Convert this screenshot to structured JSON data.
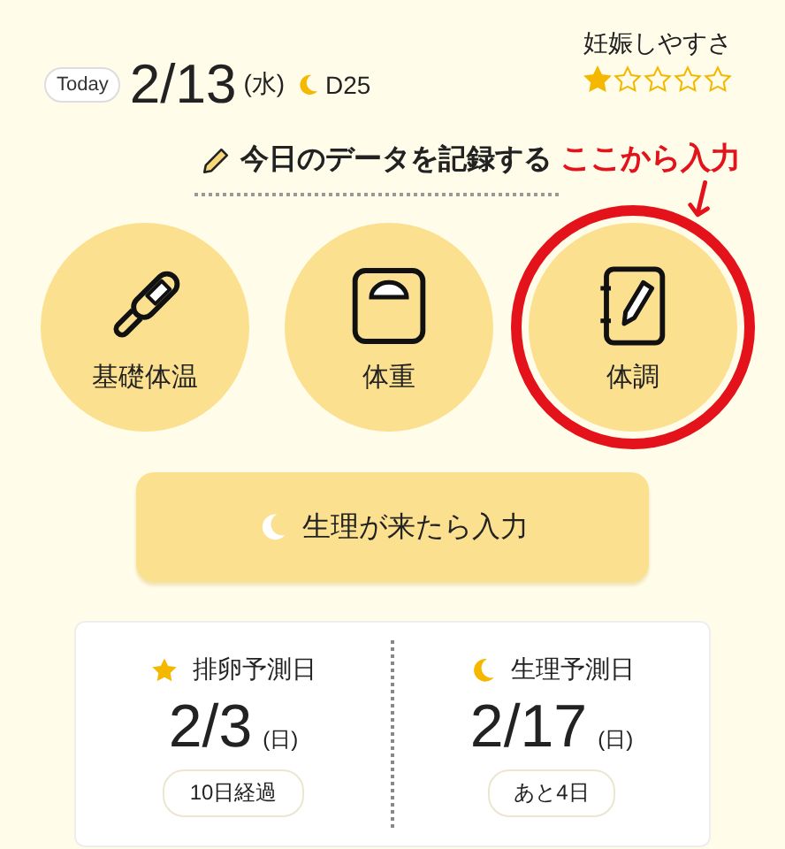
{
  "header": {
    "today_badge": "Today",
    "date": "2/13",
    "weekday": "(水)",
    "cycle_day": "D25",
    "fertility": {
      "label": "妊娠しやすさ",
      "stars": 1
    }
  },
  "record": {
    "title": "今日のデータを記録する",
    "items": [
      {
        "kind": "thermometer",
        "label": "基礎体温",
        "highlighted": false
      },
      {
        "kind": "scale",
        "label": "体重",
        "highlighted": false
      },
      {
        "kind": "notebook",
        "label": "体調",
        "highlighted": true
      }
    ],
    "annotation": "ここから入力",
    "period_button": "生理が来たら入力"
  },
  "predictions": [
    {
      "kind": "ovulation",
      "label": "排卵予測日",
      "date": "2/3",
      "weekday": "(日)",
      "note": "10日経過"
    },
    {
      "kind": "period",
      "label": "生理予測日",
      "date": "2/17",
      "weekday": "(日)",
      "note": "あと4日"
    }
  ]
}
